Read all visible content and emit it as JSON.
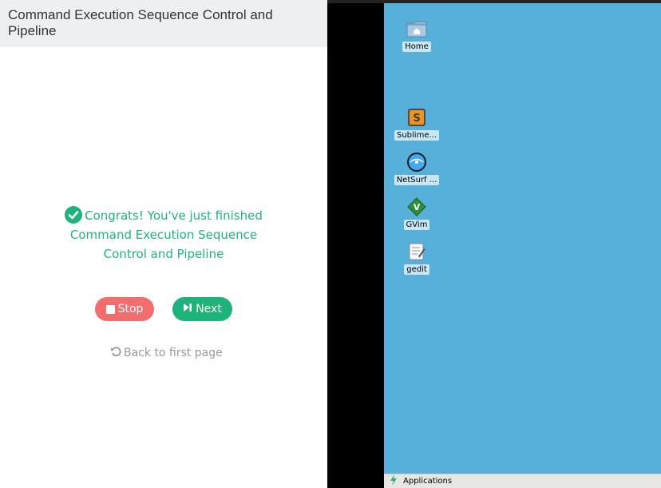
{
  "lesson": {
    "title": "Command Execution Sequence Control and Pipeline",
    "congrats_text": "Congrats! You've just finished Command Execution Sequence Control and Pipeline",
    "stop_label": "Stop",
    "next_label": "Next",
    "back_label": "Back to first page"
  },
  "desktop": {
    "icons": [
      {
        "label": "Home",
        "icon": "home-folder-icon"
      },
      {
        "label": "Sublime...",
        "icon": "sublime-text-icon"
      },
      {
        "label": "NetSurf ...",
        "icon": "netsurf-icon"
      },
      {
        "label": "GVim",
        "icon": "gvim-icon"
      },
      {
        "label": "gedit",
        "icon": "gedit-icon"
      }
    ],
    "taskbar": {
      "applications_label": "Applications"
    }
  },
  "colors": {
    "accent_green": "#1fb37c",
    "stop_red": "#f26d6d",
    "desktop_bg": "#56b0d9",
    "header_bg": "#eeeff0"
  }
}
